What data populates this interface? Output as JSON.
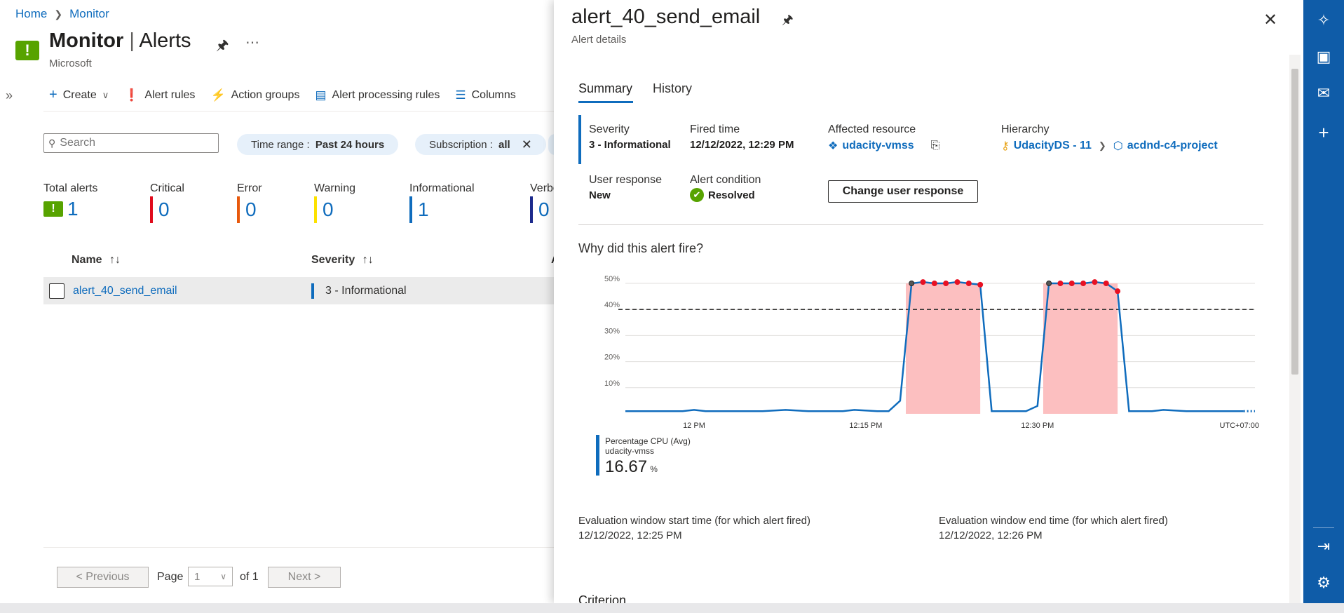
{
  "breadcrumb": {
    "home": "Home",
    "sep": ">",
    "current": "Monitor"
  },
  "page": {
    "title_main": "Monitor",
    "title_sep": "|",
    "title_sub": "Alerts",
    "subtitle": "Microsoft"
  },
  "commands": {
    "create": "Create",
    "alert_rules": "Alert rules",
    "action_groups": "Action groups",
    "processing_rules": "Alert processing rules",
    "columns": "Columns"
  },
  "search": {
    "placeholder": "Search"
  },
  "filters": {
    "time_label": "Time range : ",
    "time_value": "Past 24 hours",
    "sub_label": "Subscription : ",
    "sub_value": "all"
  },
  "tiles": [
    {
      "label": "Total alerts",
      "value": "1",
      "color": "#57a300"
    },
    {
      "label": "Critical",
      "value": "0",
      "color": "#e00b1c"
    },
    {
      "label": "Error",
      "value": "0",
      "color": "#e8590c"
    },
    {
      "label": "Warning",
      "value": "0",
      "color": "#fce100"
    },
    {
      "label": "Informational",
      "value": "1",
      "color": "#0f6cbd"
    },
    {
      "label": "Verbo",
      "value": "0",
      "color": "#1c2a8c"
    }
  ],
  "table": {
    "headers": {
      "name": "Name",
      "severity": "Severity",
      "next": "A"
    },
    "rows": [
      {
        "name": "alert_40_send_email",
        "severity": "3 - Informational"
      }
    ]
  },
  "pagination": {
    "previous": "< Previous",
    "page": "Page",
    "value": "1",
    "of": "of 1",
    "next": "Next >"
  },
  "panel": {
    "title": "alert_40_send_email",
    "subtitle": "Alert details",
    "tabs": {
      "summary": "Summary",
      "history": "History"
    },
    "severity_label": "Severity",
    "severity_value": "3 - Informational",
    "fired_label": "Fired time",
    "fired_value": "12/12/2022, 12:29 PM",
    "resource_label": "Affected resource",
    "resource_value": "udacity-vmss",
    "hierarchy_label": "Hierarchy",
    "hierarchy_1": "UdacityDS - 11",
    "hierarchy_2": "acdnd-c4-project",
    "response_label": "User response",
    "response_value": "New",
    "condition_label": "Alert condition",
    "condition_value": "Resolved",
    "change_button": "Change user response",
    "why_title": "Why did this alert fire?",
    "legend_metric": "Percentage CPU (Avg)",
    "legend_resource": "udacity-vmss",
    "legend_value": "16.67",
    "legend_unit": "%",
    "eval_start_label": "Evaluation window start time (for which alert fired)",
    "eval_start_value": "12/12/2022, 12:25 PM",
    "eval_end_label": "Evaluation window end time (for which alert fired)",
    "eval_end_value": "12/12/2022, 12:26 PM",
    "criterion": "Criterion"
  },
  "chart_data": {
    "type": "line",
    "series": [
      {
        "name": "Percentage CPU (Avg)",
        "points": [
          [
            0,
            1
          ],
          [
            5,
            1
          ],
          [
            6,
            1.5
          ],
          [
            7,
            1
          ],
          [
            12,
            1
          ],
          [
            14,
            1.5
          ],
          [
            16,
            1
          ],
          [
            19,
            1
          ],
          [
            20,
            1.5
          ],
          [
            22,
            1
          ],
          [
            23,
            1
          ],
          [
            24,
            5
          ],
          [
            25,
            50
          ],
          [
            26,
            50.5
          ],
          [
            27,
            50
          ],
          [
            28,
            50
          ],
          [
            29,
            50.5
          ],
          [
            30,
            50
          ],
          [
            31,
            49.5
          ],
          [
            32,
            1
          ],
          [
            33,
            1
          ],
          [
            35,
            1
          ],
          [
            36,
            3
          ],
          [
            37,
            50
          ],
          [
            38,
            50
          ],
          [
            39,
            50
          ],
          [
            40,
            50
          ],
          [
            41,
            50.5
          ],
          [
            42,
            50
          ],
          [
            43,
            47
          ],
          [
            44,
            1
          ],
          [
            46,
            1
          ],
          [
            47,
            1.5
          ],
          [
            49,
            1
          ],
          [
            54,
            1
          ]
        ]
      }
    ],
    "threshold": 40,
    "x_unit": "minutes after 11:54 AM",
    "xticks": [
      {
        "x": 6,
        "label": "12 PM"
      },
      {
        "x": 21,
        "label": "12:15 PM"
      },
      {
        "x": 36,
        "label": "12:30 PM"
      }
    ],
    "xlim": [
      0,
      55
    ],
    "ylim": [
      0,
      50
    ],
    "yticks": [
      "10%",
      "20%",
      "30%",
      "40%",
      "50%"
    ],
    "timezone": "UTC+07:00",
    "fired_ranges": [
      [
        24.5,
        31
      ],
      [
        36.5,
        43
      ]
    ],
    "colors": {
      "line": "#0f6cbd",
      "fill": "#fcbfc0",
      "point": "#e81123",
      "threshold": "#323130"
    }
  }
}
